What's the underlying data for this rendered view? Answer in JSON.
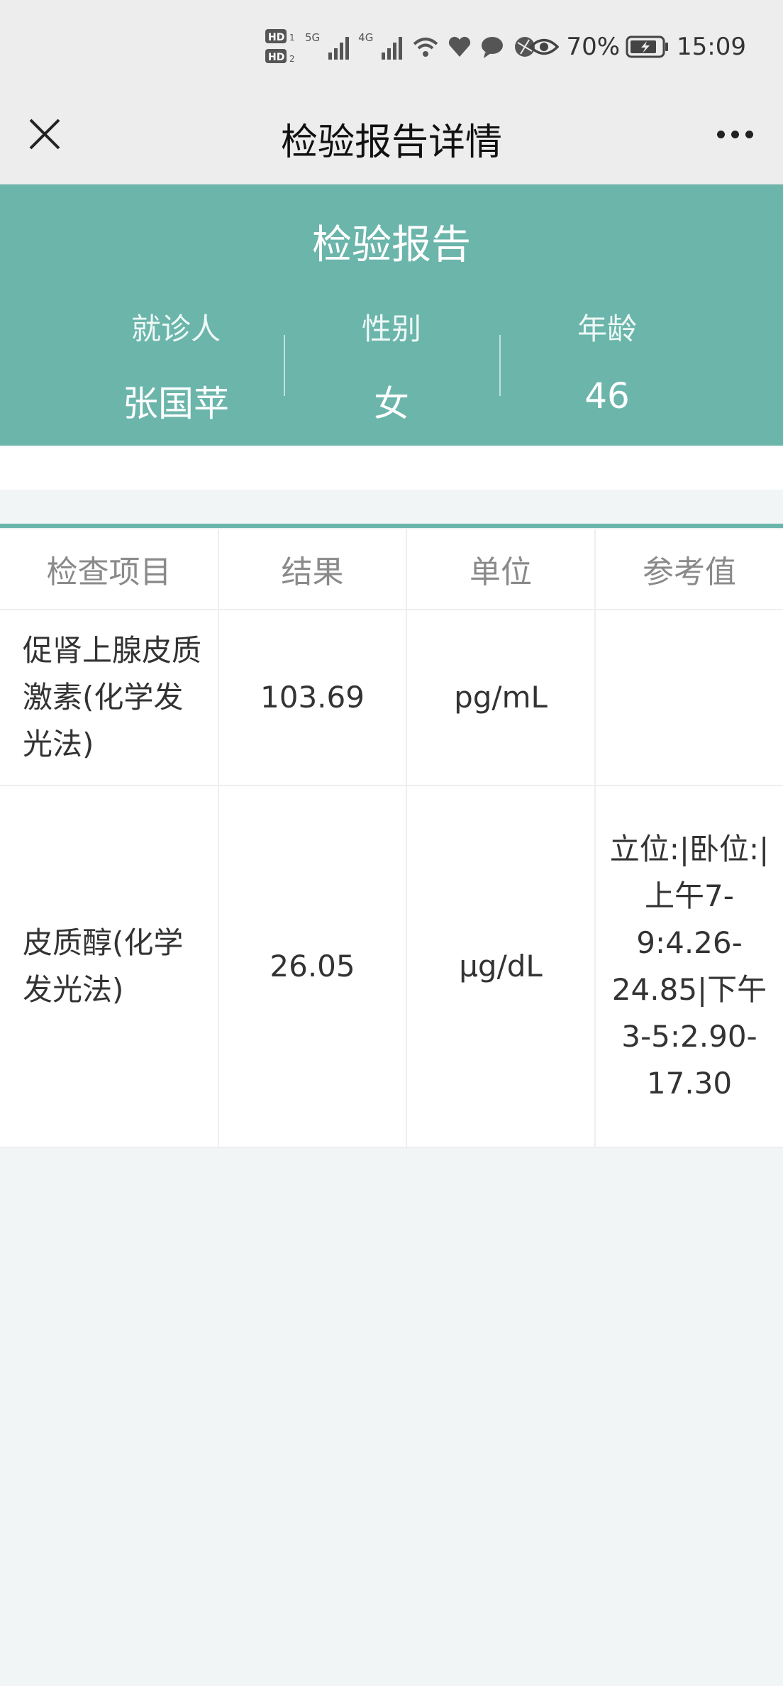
{
  "status_bar": {
    "network_1": "5G",
    "network_2": "4G",
    "battery": "70%",
    "time": "15:09"
  },
  "nav": {
    "title": "检验报告详情"
  },
  "report": {
    "title": "检验报告",
    "patient_label": "就诊人",
    "patient_value": "张国苹",
    "gender_label": "性别",
    "gender_value": "女",
    "age_label": "年龄",
    "age_value": "46"
  },
  "table": {
    "headers": [
      "检查项目",
      "结果",
      "单位",
      "参考值"
    ],
    "rows": [
      {
        "item": "促肾上腺皮质激素(化学发光法)",
        "result": "103.69",
        "unit": "pg/mL",
        "reference": ""
      },
      {
        "item": "皮质醇(化学发光法)",
        "result": "26.05",
        "unit": "μg/dL",
        "reference": "立位:|卧位:|上午7-9:4.26-24.85|下午3-5:2.90-17.30"
      }
    ]
  },
  "colors": {
    "accent": "#6bb5ab",
    "background": "#f2f5f5"
  }
}
